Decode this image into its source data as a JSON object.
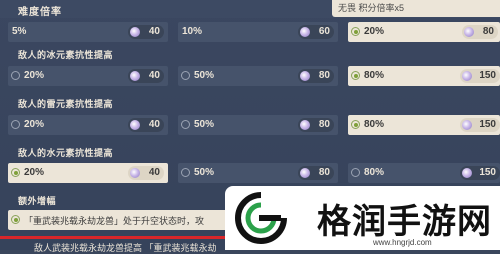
{
  "header": {
    "title": "难度倍率",
    "right_text": "无畏  积分倍率x5"
  },
  "top_row": [
    {
      "pct": "5%",
      "value": "40",
      "selected": false
    },
    {
      "pct": "10%",
      "value": "60",
      "selected": false
    },
    {
      "pct": "20%",
      "value": "80",
      "selected": true
    }
  ],
  "sections": [
    {
      "title": "敌人的冰元素抗性提高",
      "options": [
        {
          "pct": "20%",
          "value": "40",
          "selected": false
        },
        {
          "pct": "50%",
          "value": "80",
          "selected": false
        },
        {
          "pct": "80%",
          "value": "150",
          "selected": true
        }
      ]
    },
    {
      "title": "敌人的雷元素抗性提高",
      "options": [
        {
          "pct": "20%",
          "value": "40",
          "selected": false
        },
        {
          "pct": "50%",
          "value": "80",
          "selected": false
        },
        {
          "pct": "80%",
          "value": "150",
          "selected": true
        }
      ]
    },
    {
      "title": "敌人的水元素抗性提高",
      "options": [
        {
          "pct": "20%",
          "value": "40",
          "selected": true
        },
        {
          "pct": "50%",
          "value": "80",
          "selected": false
        },
        {
          "pct": "80%",
          "value": "150",
          "selected": false
        }
      ]
    }
  ],
  "extra": {
    "title": "额外增幅",
    "option_text": "「重武装兆载永劫龙兽」处于升空状态时，攻",
    "cut_text": "敌人武装兆载永劫龙兽提高 「重武装兆载永劫"
  },
  "watermark": {
    "name": "格润手游网",
    "url": "www.hngrjd.com"
  }
}
